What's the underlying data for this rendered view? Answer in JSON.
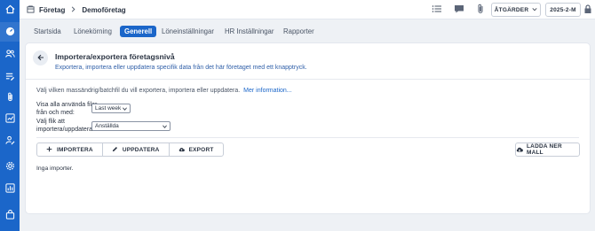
{
  "header": {
    "breadcrumb_root": "Företag",
    "breadcrumb_current": "Demoföretag",
    "actions_label": "ÅTGÄRDER",
    "period_label": "2025-2-M"
  },
  "tabs": [
    {
      "label": "Startsida"
    },
    {
      "label": "Lönekörning"
    },
    {
      "label": "Generell"
    },
    {
      "label": "Löneinställningar"
    },
    {
      "label": "HR Inställningar"
    },
    {
      "label": "Rapporter"
    }
  ],
  "page": {
    "title": "Importera/exportera företagsnivå",
    "subtitle": "Exportera, importera eller uppdatera specifik data från det här företaget med ett knapptryck.",
    "intro": "Välj vilken massändrig/batchfil du vill exportera, importera eller uppdatera.",
    "more_info_link": "Mer information..."
  },
  "filter": {
    "label_line1": "Visa alla använda filer",
    "label_line2": "från och med:",
    "value": "Last week"
  },
  "file_select": {
    "label_line1": "Välj flik att",
    "label_line2": "importera/uppdatera:",
    "value": "Anställda"
  },
  "actions": {
    "import_label": "IMPORTERA",
    "update_label": "UPPDATERA",
    "export_label": "EXPORT",
    "download_template_label": "LADDA NER MALL"
  },
  "empty_state": "Inga importer.",
  "colors": {
    "accent": "#1b66c9",
    "background": "#eef1f5"
  },
  "icons": {
    "rail": [
      "home-icon",
      "dashboard-icon",
      "people-icon",
      "list-edit-icon",
      "paperclip-icon",
      "report-icon",
      "person-edit-icon",
      "gear-icon",
      "chart-icon",
      "bag-icon"
    ]
  }
}
